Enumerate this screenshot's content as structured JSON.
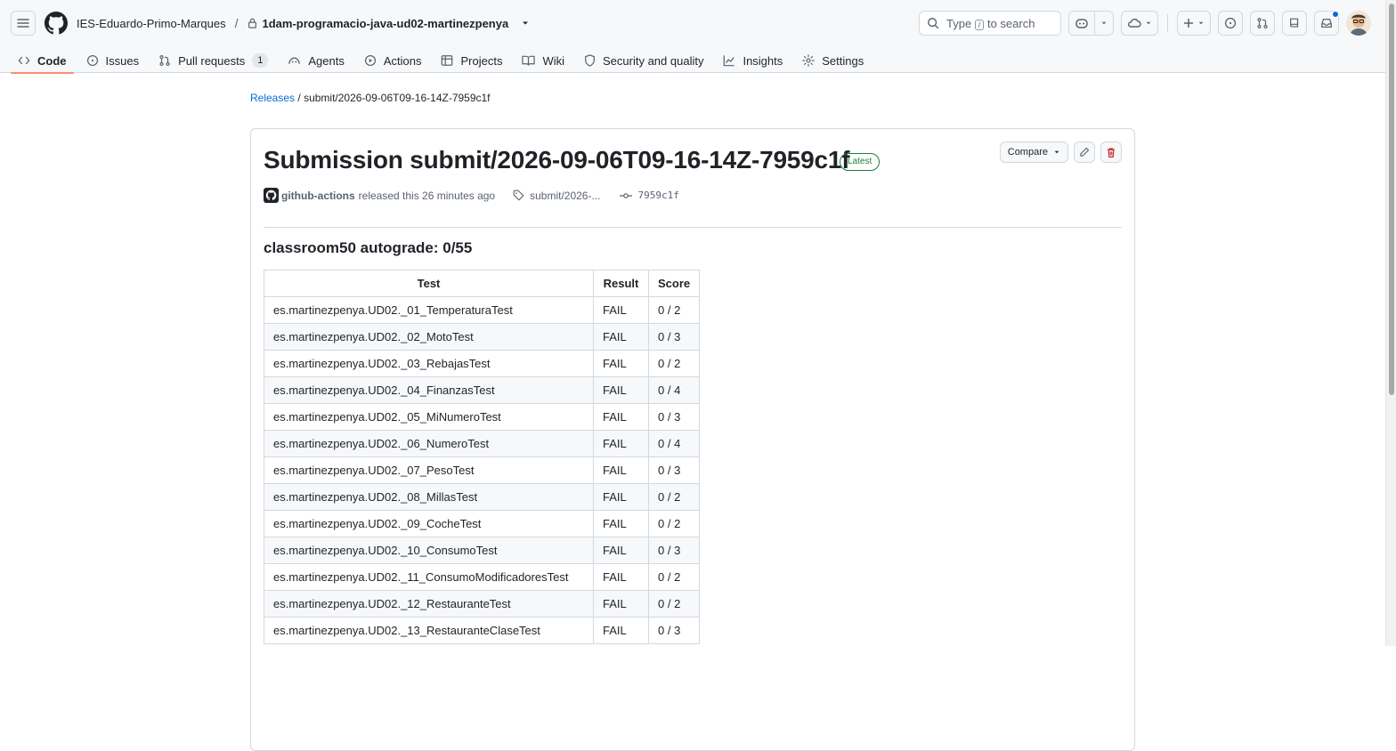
{
  "header": {
    "owner": "IES-Eduardo-Primo-Marques",
    "separator": "/",
    "repo": "1dam-programacio-java-ud02-martinezpenya",
    "search_text_before": "Type",
    "search_key": "/",
    "search_text_after": "to search"
  },
  "tabs": [
    {
      "label": "Code",
      "icon": "code-icon",
      "active": true
    },
    {
      "label": "Issues",
      "icon": "issue-icon"
    },
    {
      "label": "Pull requests",
      "icon": "pull-request-icon",
      "counter": "1"
    },
    {
      "label": "Agents",
      "icon": "agents-icon"
    },
    {
      "label": "Actions",
      "icon": "play-icon"
    },
    {
      "label": "Projects",
      "icon": "table-icon"
    },
    {
      "label": "Wiki",
      "icon": "book-icon"
    },
    {
      "label": "Security and quality",
      "icon": "shield-icon"
    },
    {
      "label": "Insights",
      "icon": "graph-icon"
    },
    {
      "label": "Settings",
      "icon": "gear-icon"
    }
  ],
  "release": {
    "crumb_link": "Releases",
    "crumb_sep": "/",
    "crumb_current": "submit/2026-09-06T09-16-14Z-7959c1f",
    "title": "Submission submit/2026-09-06T09-16-14Z-7959c1f",
    "badge": "Latest",
    "compare_label": "Compare",
    "author": "github-actions",
    "released_text": "released this 26 minutes ago",
    "tag": "submit/2026-...",
    "commit": "7959c1f",
    "autograde_heading": "classroom50 autograde: 0/55"
  },
  "table": {
    "headers": [
      "Test",
      "Result",
      "Score"
    ],
    "rows": [
      [
        "es.martinezpenya.UD02._01_TemperaturaTest",
        "FAIL",
        "0 / 2"
      ],
      [
        "es.martinezpenya.UD02._02_MotoTest",
        "FAIL",
        "0 / 3"
      ],
      [
        "es.martinezpenya.UD02._03_RebajasTest",
        "FAIL",
        "0 / 2"
      ],
      [
        "es.martinezpenya.UD02._04_FinanzasTest",
        "FAIL",
        "0 / 4"
      ],
      [
        "es.martinezpenya.UD02._05_MiNumeroTest",
        "FAIL",
        "0 / 3"
      ],
      [
        "es.martinezpenya.UD02._06_NumeroTest",
        "FAIL",
        "0 / 4"
      ],
      [
        "es.martinezpenya.UD02._07_PesoTest",
        "FAIL",
        "0 / 3"
      ],
      [
        "es.martinezpenya.UD02._08_MillasTest",
        "FAIL",
        "0 / 2"
      ],
      [
        "es.martinezpenya.UD02._09_CocheTest",
        "FAIL",
        "0 / 2"
      ],
      [
        "es.martinezpenya.UD02._10_ConsumoTest",
        "FAIL",
        "0 / 3"
      ],
      [
        "es.martinezpenya.UD02._11_ConsumoModificadoresTest",
        "FAIL",
        "0 / 2"
      ],
      [
        "es.martinezpenya.UD02._12_RestauranteTest",
        "FAIL",
        "0 / 2"
      ],
      [
        "es.martinezpenya.UD02._13_RestauranteClaseTest",
        "FAIL",
        "0 / 3"
      ]
    ]
  },
  "colors": {
    "accent": "#0969da",
    "tab_underline": "#fd8c73",
    "latest_green": "#1a7f37",
    "delete_red": "#cf222e"
  }
}
